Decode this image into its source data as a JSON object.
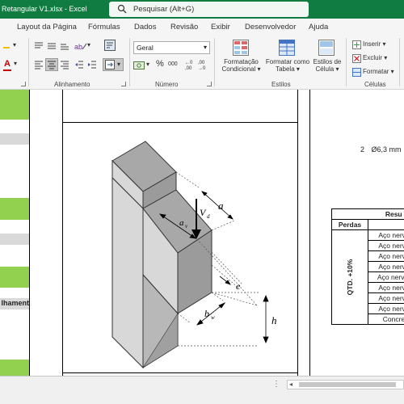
{
  "window": {
    "title": "Retangular V1.xlsx  -  Excel"
  },
  "search": {
    "placeholder": "Pesquisar (Alt+G)"
  },
  "tabs": [
    "Layout da Página",
    "Fórmulas",
    "Dados",
    "Revisão",
    "Exibir",
    "Desenvolvedor",
    "Ajuda"
  ],
  "ribbon": {
    "groups": {
      "alignment": "Alinhamento",
      "number": "Número",
      "styles": "Estilos",
      "cells": "Células"
    },
    "number_format": "Geral",
    "percent_symbol": "%",
    "thousands_symbol": "000",
    "styles": {
      "conditional": [
        "Formatação",
        "Condicional"
      ],
      "table": [
        "Formatar como",
        "Tabela"
      ],
      "cell": [
        "Estilos de",
        "Célula"
      ]
    },
    "cells": {
      "insert": "Inserir",
      "delete": "Excluir",
      "format": "Formatar"
    },
    "font_color_letter": "A"
  },
  "sheet": {
    "left_label": "lhament",
    "note": {
      "qty": "2",
      "bar": "Ø6,3 mm"
    },
    "figure_labels": {
      "a": "a",
      "av": "a",
      "av_sub": "v",
      "vd": "V",
      "vd_sub": "d",
      "e": "e",
      "bw": "b",
      "bw_sub": "w",
      "h": "h"
    },
    "summary": {
      "header": "Resu",
      "subheader": "Perdas",
      "vertical_label": "QTD. +10%",
      "rows": [
        "Aço nervu",
        "Aço nervu",
        "Aço nervu",
        "Aço nervu",
        "Aço nervur",
        "Aço nervu",
        "Aço nervu",
        "Aço nervu",
        "Concre"
      ]
    }
  },
  "colors": {
    "title_bar": "#107c41",
    "sheet_green": "#92d050",
    "sheet_grey": "#d9d9d9",
    "tab_bar": "#f5f5f5"
  }
}
